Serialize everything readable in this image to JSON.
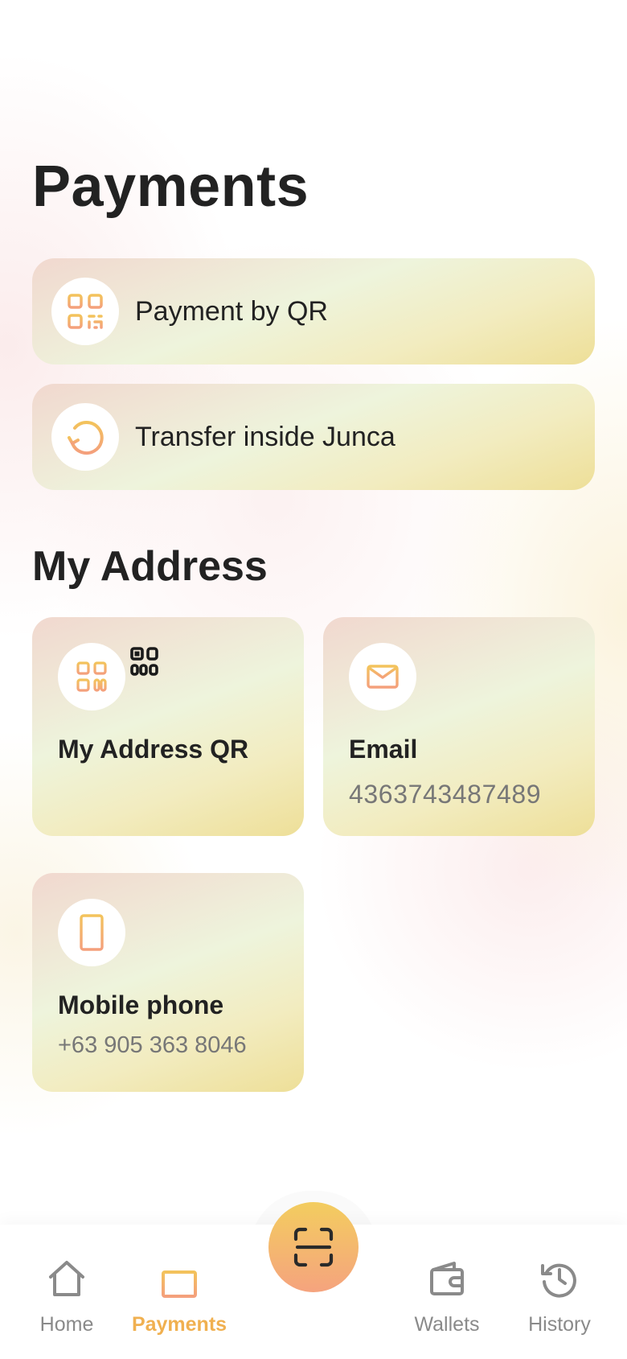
{
  "page": {
    "title": "Payments"
  },
  "actions": [
    {
      "label": "Payment by QR",
      "icon": "qr-code-icon"
    },
    {
      "label": "Transfer inside Junca",
      "icon": "refresh-icon"
    }
  ],
  "address": {
    "section_title": "My Address",
    "tiles": [
      {
        "title": "My Address QR",
        "icon": "qr-code-icon",
        "badge_icon": "qr-code-icon"
      },
      {
        "title": "Email",
        "value": "4363743487489",
        "icon": "mail-icon"
      },
      {
        "title": "Mobile phone",
        "value": "+63 905 363 8046",
        "icon": "phone-icon"
      }
    ]
  },
  "nav": {
    "items": [
      {
        "label": "Home",
        "icon": "home-icon",
        "active": false
      },
      {
        "label": "Payments",
        "icon": "payments-icon",
        "active": true
      },
      {
        "label": "Wallets",
        "icon": "wallet-icon",
        "active": false
      },
      {
        "label": "History",
        "icon": "history-icon",
        "active": false
      }
    ],
    "scan_icon": "scan-icon"
  },
  "colors": {
    "accent_gradient_start": "#f3cd5f",
    "accent_gradient_end": "#f5a37e",
    "active_nav": "#f0b050",
    "inactive_nav": "#8a8a8a",
    "text_primary": "#222222",
    "text_secondary": "#777777"
  }
}
